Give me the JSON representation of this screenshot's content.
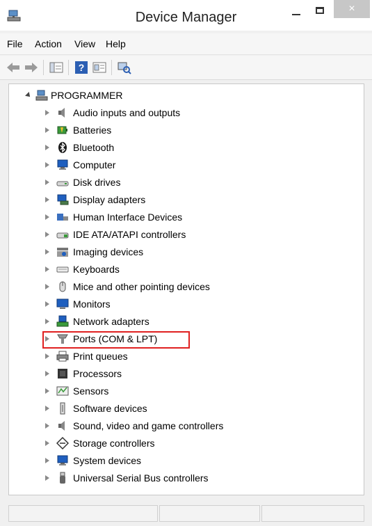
{
  "window": {
    "title": "Device Manager",
    "close_glyph": "×"
  },
  "menu": {
    "items": [
      "File",
      "Action",
      "View",
      "Help"
    ]
  },
  "toolbar": {
    "buttons": [
      "back-arrow-icon",
      "forward-arrow-icon",
      "show-hide-console-tree-icon",
      "help-icon",
      "properties-icon",
      "scan-hardware-icon"
    ]
  },
  "tree": {
    "root": {
      "label": "PROGRAMMER",
      "expanded": true
    },
    "items": [
      {
        "label": "Audio inputs and outputs",
        "icon": "speaker-icon"
      },
      {
        "label": "Batteries",
        "icon": "battery-icon"
      },
      {
        "label": "Bluetooth",
        "icon": "bluetooth-icon"
      },
      {
        "label": "Computer",
        "icon": "computer-icon"
      },
      {
        "label": "Disk drives",
        "icon": "disk-drive-icon"
      },
      {
        "label": "Display adapters",
        "icon": "display-adapter-icon"
      },
      {
        "label": "Human Interface Devices",
        "icon": "hid-icon"
      },
      {
        "label": "IDE ATA/ATAPI controllers",
        "icon": "ide-controller-icon"
      },
      {
        "label": "Imaging devices",
        "icon": "camera-icon"
      },
      {
        "label": "Keyboards",
        "icon": "keyboard-icon"
      },
      {
        "label": "Mice and other pointing devices",
        "icon": "mouse-icon"
      },
      {
        "label": "Monitors",
        "icon": "monitor-icon"
      },
      {
        "label": "Network adapters",
        "icon": "network-adapter-icon"
      },
      {
        "label": "Ports (COM & LPT)",
        "icon": "port-icon",
        "highlighted": true
      },
      {
        "label": "Print queues",
        "icon": "printer-icon"
      },
      {
        "label": "Processors",
        "icon": "processor-icon"
      },
      {
        "label": "Sensors",
        "icon": "sensor-icon"
      },
      {
        "label": "Software devices",
        "icon": "software-device-icon"
      },
      {
        "label": "Sound, video and game controllers",
        "icon": "sound-controller-icon"
      },
      {
        "label": "Storage controllers",
        "icon": "storage-controller-icon"
      },
      {
        "label": "System devices",
        "icon": "system-device-icon"
      },
      {
        "label": "Universal Serial Bus controllers",
        "icon": "usb-icon"
      }
    ]
  },
  "colors": {
    "highlight_border": "#e02020",
    "close_button": "#c7c7c7"
  }
}
